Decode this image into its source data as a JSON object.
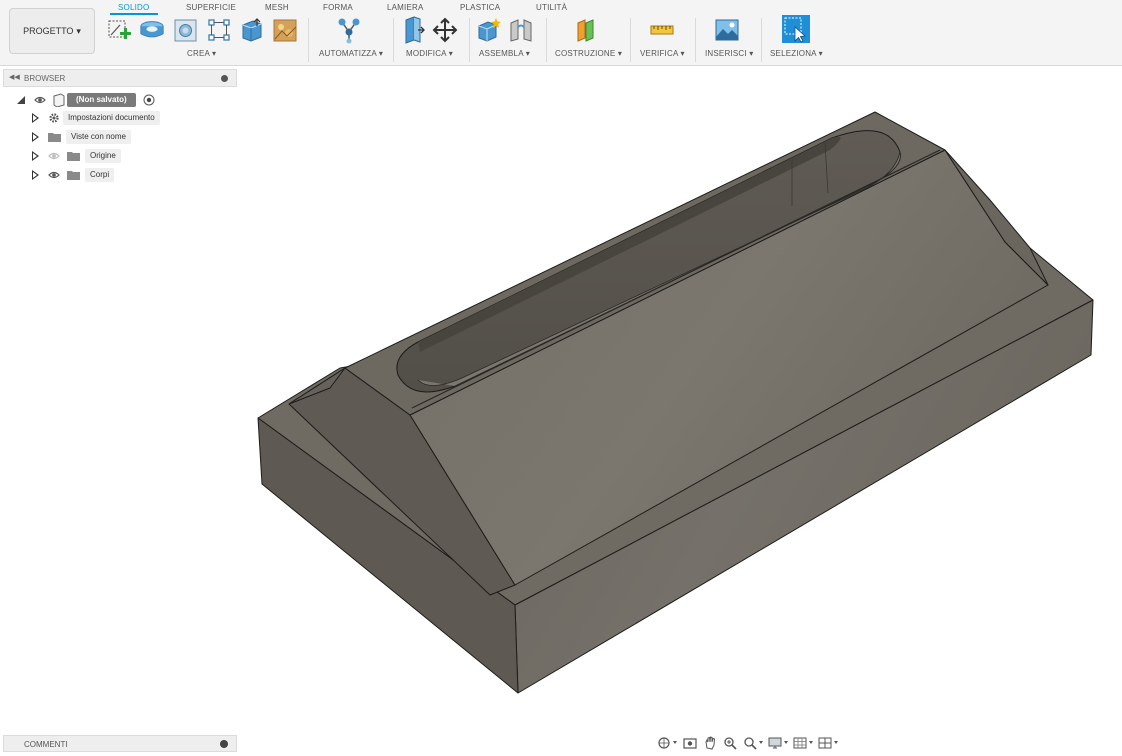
{
  "toolbar": {
    "project_label": "PROGETTO",
    "tabs": [
      {
        "label": "SOLIDO",
        "active": true
      },
      {
        "label": "SUPERFICIE",
        "active": false
      },
      {
        "label": "MESH",
        "active": false
      },
      {
        "label": "FORMA",
        "active": false
      },
      {
        "label": "LAMIERA",
        "active": false
      },
      {
        "label": "PLASTICA",
        "active": false
      },
      {
        "label": "UTILITÀ",
        "active": false
      }
    ],
    "groups": {
      "crea": {
        "label": "CREA ▾",
        "icons": [
          "create-sketch-icon",
          "extrude-icon",
          "hole-icon",
          "sketch-pattern-icon",
          "box-icon",
          "decal-icon"
        ]
      },
      "automatizza": {
        "label": "AUTOMATIZZA ▾",
        "icons": [
          "automate-icon"
        ]
      },
      "modifica": {
        "label": "MODIFICA ▾",
        "icons": [
          "press-pull-icon",
          "move-icon"
        ]
      },
      "assembla": {
        "label": "ASSEMBLA ▾",
        "icons": [
          "new-component-icon",
          "joint-icon"
        ]
      },
      "costruzione": {
        "label": "COSTRUZIONE ▾",
        "icons": [
          "offset-plane-icon"
        ]
      },
      "verifica": {
        "label": "VERIFICA ▾",
        "icons": [
          "measure-icon"
        ]
      },
      "inserisci": {
        "label": "INSERISCI ▾",
        "icons": [
          "insert-image-icon"
        ]
      },
      "seleziona": {
        "label": "SELEZIONA ▾",
        "icons": [
          "select-icon"
        ]
      }
    },
    "accent_color": "#0696d7"
  },
  "browser": {
    "title": "BROWSER",
    "root": {
      "label": "(Non salvato)"
    },
    "items": [
      {
        "label": "Impostazioni documento",
        "icon": "gear-icon"
      },
      {
        "label": "Viste con nome",
        "icon": "folder-icon"
      },
      {
        "label": "Origine",
        "icon": "folder-icon"
      },
      {
        "label": "Corpi",
        "icon": "folder-icon"
      }
    ]
  },
  "comments": {
    "title": "COMMENTI"
  },
  "viewport": {
    "model": "solid-body",
    "body_color": "#6e6a62"
  },
  "navbar": {
    "icons": [
      "orbit-icon",
      "look-at-icon",
      "pan-icon",
      "zoom-icon",
      "fit-icon",
      "display-settings-icon",
      "grid-settings-icon",
      "viewports-icon"
    ]
  }
}
